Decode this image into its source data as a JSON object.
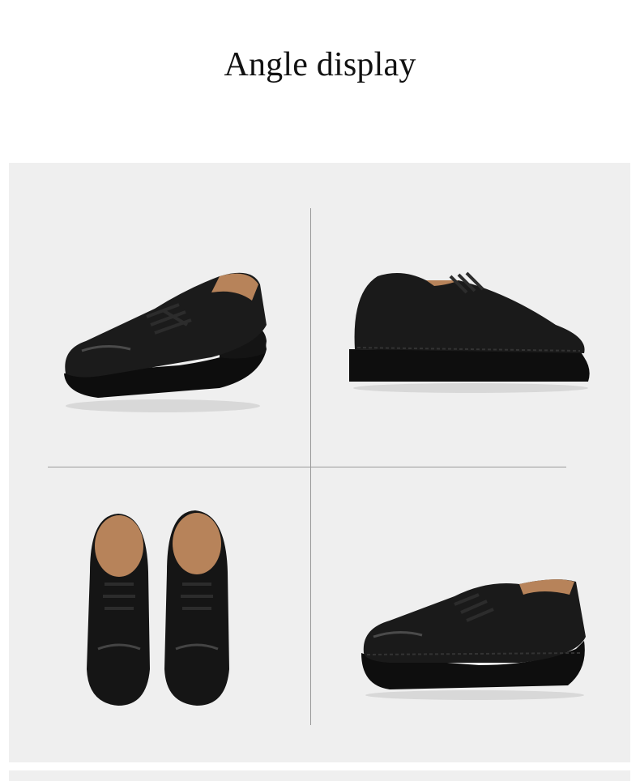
{
  "header": {
    "title": "Angle display"
  },
  "gallery": {
    "background": "#efefef",
    "divider_color": "#9a9a9a",
    "views": [
      {
        "name": "three-quarter-front",
        "color": "#141414"
      },
      {
        "name": "side-profile",
        "color": "#141414"
      },
      {
        "name": "top-pair",
        "color": "#141414"
      },
      {
        "name": "side-angle",
        "color": "#141414"
      }
    ]
  }
}
